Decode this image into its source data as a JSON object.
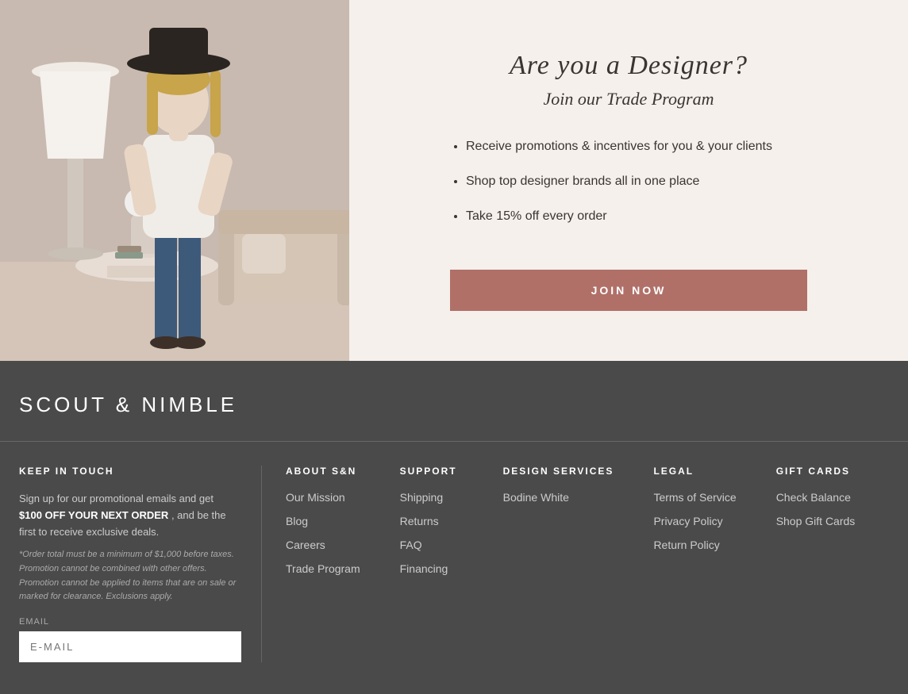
{
  "top": {
    "title": "Are you a Designer?",
    "subtitle": "Join our Trade Program",
    "benefits": [
      "Receive promotions & incentives for you & your clients",
      "Shop top designer brands all in one place",
      "Take 15% off every order"
    ],
    "join_button": "JOIN NOW"
  },
  "footer": {
    "logo": "SCOUT & NIMBLE",
    "keep_in_touch": {
      "title": "KEEP IN TOUCH",
      "description_1": "Sign up for our promotional emails and get",
      "highlight": "$100 OFF YOUR NEXT ORDER",
      "description_2": ", and be the first to receive exclusive deals.",
      "fine_print": "*Order total must be a minimum of $1,000 before taxes. Promotion cannot be combined with other offers. Promotion cannot be applied to items that are on sale or marked for clearance. Exclusions apply.",
      "email_label": "Email",
      "email_placeholder": "E-MAIL"
    },
    "about": {
      "title": "ABOUT S&N",
      "links": [
        "Our Mission",
        "Blog",
        "Careers",
        "Trade Program"
      ]
    },
    "support": {
      "title": "SUPPORT",
      "links": [
        "Shipping",
        "Returns",
        "FAQ",
        "Financing"
      ]
    },
    "design_services": {
      "title": "DESIGN SERVICES",
      "links": [
        "Bodine White"
      ]
    },
    "legal": {
      "title": "LEGAL",
      "links": [
        "Terms of Service",
        "Privacy Policy",
        "Return Policy"
      ]
    },
    "gift_cards": {
      "title": "GIFT CARDS",
      "links": [
        "Check Balance",
        "Shop Gift Cards"
      ]
    }
  }
}
